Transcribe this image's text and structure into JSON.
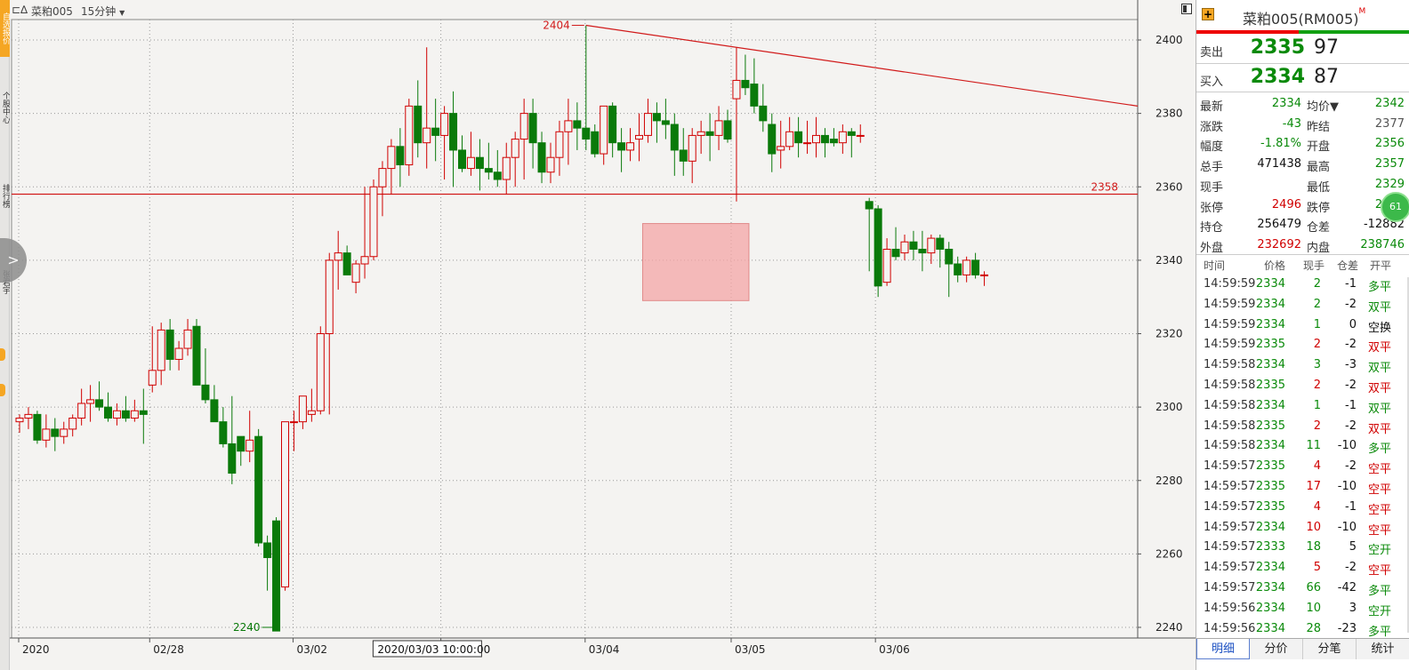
{
  "header": {
    "symbol": "菜粕005",
    "period": "15分钟"
  },
  "left_toolbar": {
    "labels": [
      "自选报价",
      "个股中心",
      "排行榜",
      "张君宇"
    ]
  },
  "colors": {
    "up": "#d00000",
    "down": "#0a7a0a",
    "line": "#d11a1a",
    "box": "#f4a6a6"
  },
  "chart_data": {
    "type": "candlestick",
    "title": "",
    "ylim": [
      2234,
      2410
    ],
    "yticks": [
      2240,
      2260,
      2280,
      2300,
      2320,
      2340,
      2360,
      2380,
      2400
    ],
    "xticks": [
      "2020",
      "02/28",
      "03/02",
      "03/03",
      "03/04",
      "03/05",
      "03/06"
    ],
    "crosshair_date_label": "2020/03/03 10:00:00",
    "annotations": {
      "high": "2404",
      "low": "2240",
      "level": "2358"
    },
    "horizontal_line": 2358,
    "trendline": [
      [
        2404,
        2382
      ]
    ],
    "highlight_box": {
      "from_candle": 71,
      "to_candle": 81,
      "price_low": 2329,
      "price_high": 2350
    },
    "candles": [
      [
        2296,
        2298,
        2293,
        2297
      ],
      [
        2297,
        2300,
        2294,
        2298
      ],
      [
        2298,
        2299,
        2290,
        2291
      ],
      [
        2291,
        2298,
        2289,
        2294
      ],
      [
        2294,
        2297,
        2288,
        2292
      ],
      [
        2292,
        2296,
        2290,
        2294
      ],
      [
        2294,
        2298,
        2292,
        2297
      ],
      [
        2297,
        2305,
        2295,
        2301
      ],
      [
        2301,
        2306,
        2296,
        2302
      ],
      [
        2302,
        2307,
        2299,
        2300
      ],
      [
        2300,
        2304,
        2296,
        2297
      ],
      [
        2297,
        2301,
        2295,
        2299
      ],
      [
        2299,
        2303,
        2296,
        2297
      ],
      [
        2297,
        2302,
        2296,
        2299
      ],
      [
        2299,
        2305,
        2290,
        2298
      ],
      [
        2306,
        2322,
        2304,
        2310
      ],
      [
        2310,
        2323,
        2306,
        2321
      ],
      [
        2321,
        2324,
        2310,
        2313
      ],
      [
        2313,
        2318,
        2310,
        2316
      ],
      [
        2316,
        2324,
        2314,
        2321
      ],
      [
        2322,
        2324,
        2312,
        2306
      ],
      [
        2306,
        2316,
        2301,
        2302
      ],
      [
        2302,
        2306,
        2298,
        2296
      ],
      [
        2296,
        2300,
        2289,
        2290
      ],
      [
        2290,
        2303,
        2279,
        2282
      ],
      [
        2292,
        2290,
        2284,
        2288
      ],
      [
        2288,
        2299,
        2285,
        2291
      ],
      [
        2292,
        2294,
        2262,
        2263
      ],
      [
        2263,
        2265,
        2250,
        2259
      ],
      [
        2269,
        2270,
        2240,
        2239
      ],
      [
        2251,
        2296,
        2250,
        2296
      ],
      [
        2296,
        2299,
        2288,
        2296
      ],
      [
        2296,
        2303,
        2294,
        2303
      ],
      [
        2298,
        2305,
        2296,
        2299
      ],
      [
        2299,
        2322,
        2298,
        2320
      ],
      [
        2320,
        2342,
        2298,
        2340
      ],
      [
        2340,
        2348,
        2332,
        2342
      ],
      [
        2342,
        2344,
        2336,
        2336
      ],
      [
        2334,
        2340,
        2331,
        2339
      ],
      [
        2339,
        2360,
        2335,
        2341
      ],
      [
        2341,
        2362,
        2340,
        2360
      ],
      [
        2360,
        2367,
        2352,
        2365
      ],
      [
        2365,
        2373,
        2358,
        2371
      ],
      [
        2371,
        2376,
        2360,
        2366
      ],
      [
        2366,
        2384,
        2363,
        2382
      ],
      [
        2382,
        2389,
        2368,
        2372
      ],
      [
        2372,
        2398,
        2365,
        2376
      ],
      [
        2376,
        2384,
        2367,
        2374
      ],
      [
        2374,
        2382,
        2362,
        2380
      ],
      [
        2380,
        2386,
        2360,
        2370
      ],
      [
        2370,
        2374,
        2364,
        2365
      ],
      [
        2365,
        2375,
        2363,
        2368
      ],
      [
        2368,
        2373,
        2359,
        2365
      ],
      [
        2365,
        2372,
        2362,
        2364
      ],
      [
        2364,
        2370,
        2360,
        2362
      ],
      [
        2362,
        2372,
        2358,
        2368
      ],
      [
        2368,
        2375,
        2360,
        2373
      ],
      [
        2373,
        2384,
        2362,
        2380
      ],
      [
        2380,
        2384,
        2365,
        2372
      ],
      [
        2372,
        2375,
        2361,
        2364
      ],
      [
        2364,
        2372,
        2361,
        2368
      ],
      [
        2368,
        2378,
        2363,
        2375
      ],
      [
        2375,
        2384,
        2366,
        2378
      ],
      [
        2378,
        2383,
        2370,
        2376
      ],
      [
        2376,
        2404,
        2370,
        2373
      ],
      [
        2375,
        2377,
        2368,
        2369
      ],
      [
        2369,
        2381,
        2366,
        2382
      ],
      [
        2382,
        2383,
        2368,
        2372
      ],
      [
        2372,
        2376,
        2364,
        2370
      ],
      [
        2370,
        2376,
        2367,
        2372
      ],
      [
        2373,
        2380,
        2367,
        2374
      ],
      [
        2374,
        2384,
        2372,
        2380
      ],
      [
        2380,
        2383,
        2372,
        2378
      ],
      [
        2378,
        2384,
        2373,
        2377
      ],
      [
        2377,
        2380,
        2363,
        2370
      ],
      [
        2370,
        2376,
        2363,
        2367
      ],
      [
        2367,
        2376,
        2361,
        2374
      ],
      [
        2374,
        2378,
        2369,
        2375
      ],
      [
        2375,
        2380,
        2367,
        2374
      ],
      [
        2374,
        2382,
        2370,
        2378
      ],
      [
        2378,
        2381,
        2372,
        2373
      ],
      [
        2384,
        2398,
        2356,
        2389
      ],
      [
        2389,
        2396,
        2385,
        2387
      ],
      [
        2388,
        2395,
        2380,
        2382
      ],
      [
        2382,
        2388,
        2375,
        2378
      ],
      [
        2377,
        2380,
        2364,
        2369
      ],
      [
        2370,
        2378,
        2365,
        2371
      ],
      [
        2371,
        2379,
        2370,
        2375
      ],
      [
        2375,
        2379,
        2368,
        2372
      ],
      [
        2372,
        2378,
        2369,
        2372
      ],
      [
        2372,
        2379,
        2368,
        2374
      ],
      [
        2374,
        2376,
        2368,
        2372
      ],
      [
        2373,
        2376,
        2371,
        2372
      ],
      [
        2372,
        2377,
        2369,
        2375
      ],
      [
        2375,
        2376,
        2368,
        2374
      ],
      [
        2374,
        2377,
        2372,
        2374
      ],
      [
        2356,
        2357,
        2337,
        2354
      ],
      [
        2354,
        2355,
        2330,
        2333
      ],
      [
        2334,
        2346,
        2333,
        2343
      ],
      [
        2343,
        2349,
        2340,
        2341
      ],
      [
        2342,
        2347,
        2340,
        2345
      ],
      [
        2345,
        2348,
        2340,
        2343
      ],
      [
        2343,
        2348,
        2337,
        2342
      ],
      [
        2342,
        2347,
        2339,
        2346
      ],
      [
        2346,
        2347,
        2338,
        2343
      ],
      [
        2343,
        2345,
        2330,
        2339
      ],
      [
        2339,
        2341,
        2334,
        2336
      ],
      [
        2336,
        2341,
        2334,
        2340
      ],
      [
        2340,
        2342,
        2335,
        2336
      ],
      [
        2336,
        2337,
        2333,
        2336
      ]
    ]
  },
  "panel": {
    "title": "菜粕005(RM005)",
    "title_mark": "M",
    "sell_label": "卖出",
    "sell_price": "2335",
    "sell_qty": "97",
    "buy_label": "买入",
    "buy_price": "2334",
    "buy_qty": "87",
    "stats": [
      {
        "k1": "最新",
        "v1": "2334",
        "c1": "green",
        "k2": "均价▼",
        "v2": "2342",
        "c2": "green"
      },
      {
        "k1": "涨跌",
        "v1": "-43",
        "c1": "green",
        "k2": "昨结",
        "v2": "2377",
        "c2": "gray"
      },
      {
        "k1": "幅度",
        "v1": "-1.81%",
        "c1": "green",
        "k2": "开盘",
        "v2": "2356",
        "c2": "green"
      },
      {
        "k1": "总手",
        "v1": "471438",
        "c1": "black",
        "k2": "最高",
        "v2": "2357",
        "c2": "green"
      },
      {
        "k1": "现手",
        "v1": "",
        "c1": "black",
        "k2": "最低",
        "v2": "2329",
        "c2": "green"
      },
      {
        "k1": "张停",
        "v1": "2496",
        "c1": "red",
        "k2": "跌停",
        "v2": "2258",
        "c2": "green"
      },
      {
        "k1": "持仓",
        "v1": "256479",
        "c1": "black",
        "k2": "仓差",
        "v2": "-12882",
        "c2": "black"
      },
      {
        "k1": "外盘",
        "v1": "232692",
        "c1": "red",
        "k2": "内盘",
        "v2": "238746",
        "c2": "green"
      }
    ],
    "trade_header": [
      "时间",
      "价格",
      "现手",
      "仓差",
      "开平"
    ],
    "trades": [
      {
        "t": "14:59:59",
        "p": "2334",
        "q": "2",
        "d": "-1",
        "n": "多平",
        "pc": "green",
        "qc": "green",
        "nc": "green"
      },
      {
        "t": "14:59:59",
        "p": "2334",
        "q": "2",
        "d": "-2",
        "n": "双平",
        "pc": "green",
        "qc": "green",
        "nc": "green"
      },
      {
        "t": "14:59:59",
        "p": "2334",
        "q": "1",
        "d": "0",
        "n": "空换",
        "pc": "green",
        "qc": "green",
        "nc": "black"
      },
      {
        "t": "14:59:59",
        "p": "2335",
        "q": "2",
        "d": "-2",
        "n": "双平",
        "pc": "green",
        "qc": "red",
        "nc": "red"
      },
      {
        "t": "14:59:58",
        "p": "2334",
        "q": "3",
        "d": "-3",
        "n": "双平",
        "pc": "green",
        "qc": "green",
        "nc": "green"
      },
      {
        "t": "14:59:58",
        "p": "2335",
        "q": "2",
        "d": "-2",
        "n": "双平",
        "pc": "green",
        "qc": "red",
        "nc": "red"
      },
      {
        "t": "14:59:58",
        "p": "2334",
        "q": "1",
        "d": "-1",
        "n": "双平",
        "pc": "green",
        "qc": "green",
        "nc": "green"
      },
      {
        "t": "14:59:58",
        "p": "2335",
        "q": "2",
        "d": "-2",
        "n": "双平",
        "pc": "green",
        "qc": "red",
        "nc": "red"
      },
      {
        "t": "14:59:58",
        "p": "2334",
        "q": "11",
        "d": "-10",
        "n": "多平",
        "pc": "green",
        "qc": "green",
        "nc": "green"
      },
      {
        "t": "14:59:57",
        "p": "2335",
        "q": "4",
        "d": "-2",
        "n": "空平",
        "pc": "green",
        "qc": "red",
        "nc": "red"
      },
      {
        "t": "14:59:57",
        "p": "2335",
        "q": "17",
        "d": "-10",
        "n": "空平",
        "pc": "green",
        "qc": "red",
        "nc": "red"
      },
      {
        "t": "14:59:57",
        "p": "2335",
        "q": "4",
        "d": "-1",
        "n": "空平",
        "pc": "green",
        "qc": "red",
        "nc": "red"
      },
      {
        "t": "14:59:57",
        "p": "2334",
        "q": "10",
        "d": "-10",
        "n": "空平",
        "pc": "green",
        "qc": "red",
        "nc": "red"
      },
      {
        "t": "14:59:57",
        "p": "2333",
        "q": "18",
        "d": "5",
        "n": "空开",
        "pc": "green",
        "qc": "green",
        "nc": "green"
      },
      {
        "t": "14:59:57",
        "p": "2334",
        "q": "5",
        "d": "-2",
        "n": "空平",
        "pc": "green",
        "qc": "red",
        "nc": "red"
      },
      {
        "t": "14:59:57",
        "p": "2334",
        "q": "66",
        "d": "-42",
        "n": "多平",
        "pc": "green",
        "qc": "green",
        "nc": "green"
      },
      {
        "t": "14:59:56",
        "p": "2334",
        "q": "10",
        "d": "3",
        "n": "空开",
        "pc": "green",
        "qc": "green",
        "nc": "green"
      },
      {
        "t": "14:59:56",
        "p": "2334",
        "q": "28",
        "d": "-23",
        "n": "多平",
        "pc": "green",
        "qc": "green",
        "nc": "green"
      }
    ],
    "tabs": [
      "明细",
      "分价",
      "分笔",
      "统计"
    ],
    "badge": "61"
  }
}
